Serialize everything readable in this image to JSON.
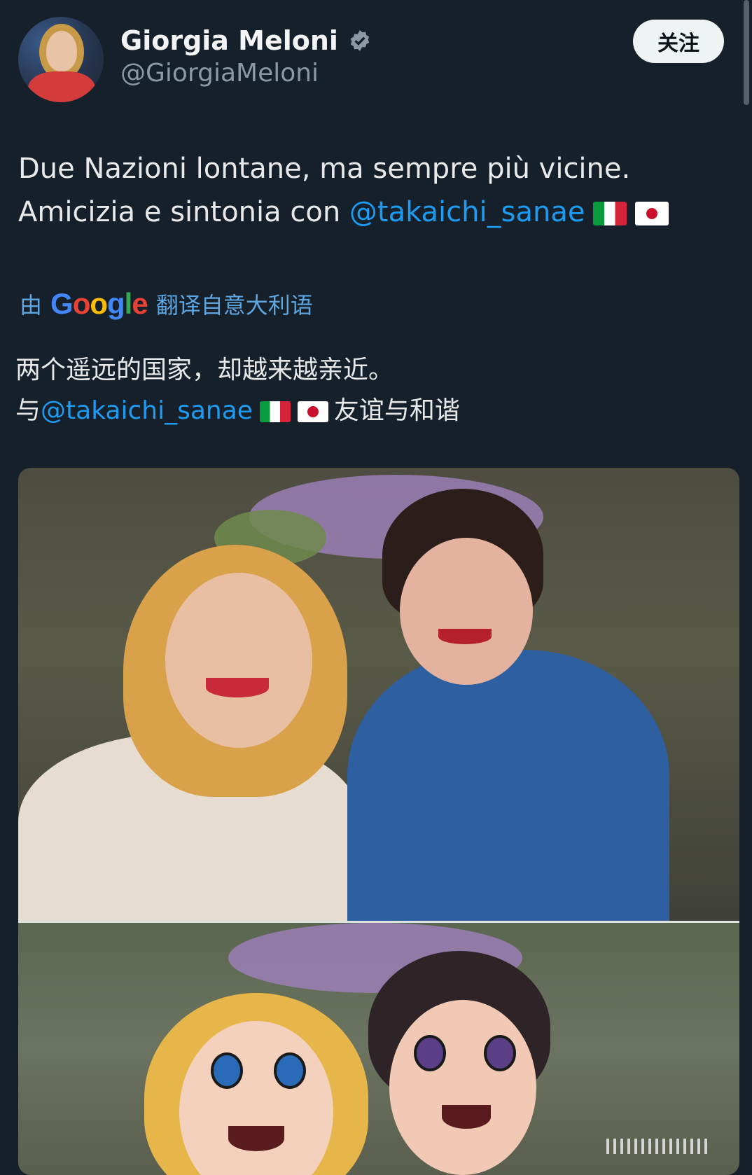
{
  "author": {
    "name": "Giorgia Meloni",
    "handle": "@GiorgiaMeloni",
    "verified_icon": "verified-badge-icon"
  },
  "follow_label": "关注",
  "tweet": {
    "line1": "Due Nazioni lontane, ma sempre più vicine.",
    "line2_prefix": "Amicizia e sintonia con ",
    "mention": "@takaichi_sanae"
  },
  "translation": {
    "by": "由",
    "google": "Google",
    "label": "翻译自意大利语",
    "line1": "两个遥远的国家，却越来越亲近。",
    "line2_prefix": "与",
    "mention": "@takaichi_sanae",
    "line2_suffix": "友谊与和谐"
  },
  "colors": {
    "background": "#16202b",
    "link": "#1d9bf0",
    "translate_link": "#5fa6e0"
  },
  "media": {
    "icons": [
      "flag-italy-icon",
      "flag-japan-icon"
    ]
  }
}
